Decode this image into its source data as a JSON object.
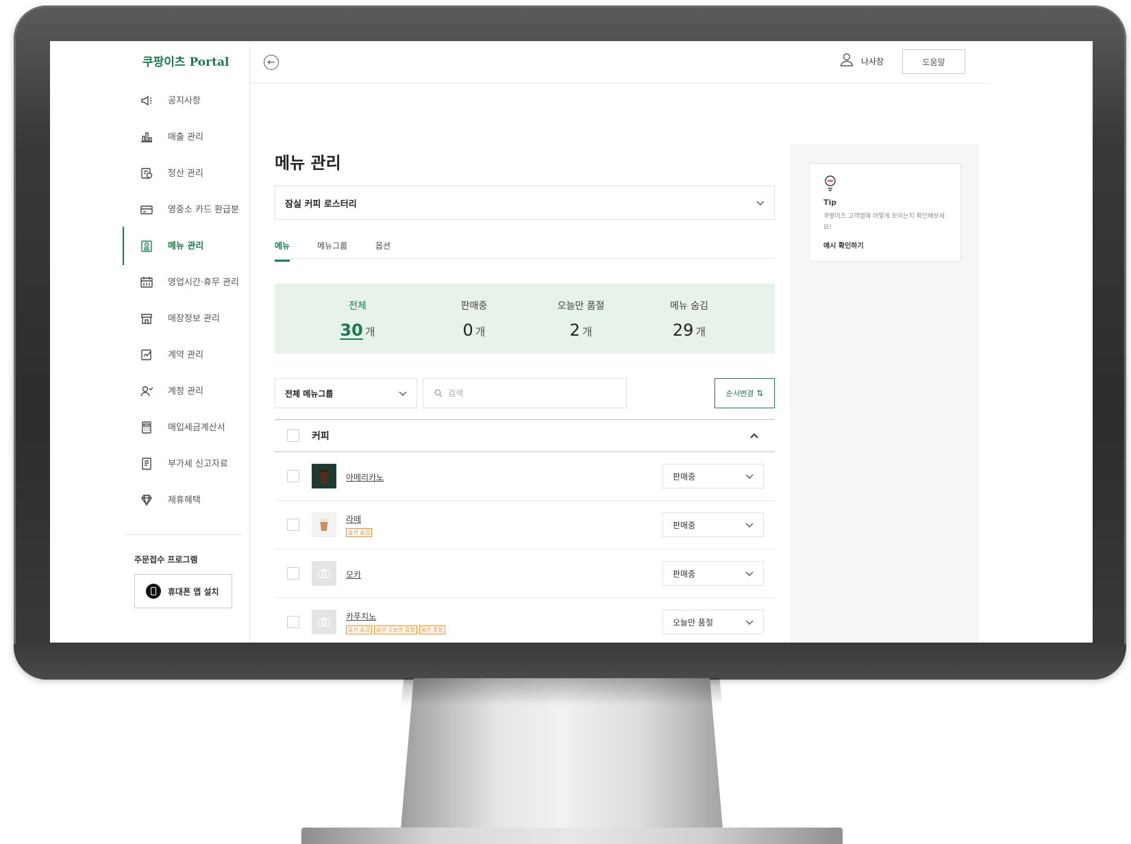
{
  "app": {
    "logo": "쿠팡이츠 Portal"
  },
  "header": {
    "user_name": "나사장",
    "help_label": "도움말"
  },
  "sidebar": {
    "items": [
      {
        "label": "공지사항",
        "icon": "megaphone-icon"
      },
      {
        "label": "매출 관리",
        "icon": "bar-chart-icon"
      },
      {
        "label": "정산 관리",
        "icon": "settlement-icon"
      },
      {
        "label": "영중소 카드 환급분",
        "icon": "card-icon"
      },
      {
        "label": "메뉴 관리",
        "icon": "menu-icon",
        "active": true
      },
      {
        "label": "영업시간·휴무 관리",
        "icon": "calendar-icon"
      },
      {
        "label": "매장정보 관리",
        "icon": "store-icon"
      },
      {
        "label": "계약 관리",
        "icon": "contract-icon"
      },
      {
        "label": "계정 관리",
        "icon": "account-icon"
      },
      {
        "label": "매입세금계산서",
        "icon": "calculator-icon"
      },
      {
        "label": "부가세 신고자료",
        "icon": "document-icon"
      },
      {
        "label": "제휴혜택",
        "icon": "diamond-icon"
      }
    ],
    "section_title": "주문접수 프로그램",
    "app_button_label": "휴대폰 앱 설치"
  },
  "main": {
    "title": "메뉴 관리",
    "store_select": "잠실 커피 로스터리",
    "tabs": [
      {
        "label": "메뉴",
        "active": true
      },
      {
        "label": "메뉴그룹"
      },
      {
        "label": "옵션"
      }
    ],
    "stats": [
      {
        "label": "전체",
        "value": "30",
        "unit": "개",
        "active": true
      },
      {
        "label": "판매중",
        "value": "0",
        "unit": "개"
      },
      {
        "label": "오늘만 품절",
        "value": "2",
        "unit": "개"
      },
      {
        "label": "메뉴 숨김",
        "value": "29",
        "unit": "개"
      }
    ],
    "group_filter": "전체 메뉴그룹",
    "search_placeholder": "검색",
    "reorder_label": "순서변경",
    "category": "커피",
    "items": [
      {
        "name": "아메리카노",
        "status": "판매중",
        "tags": [],
        "thumb": "coffee-dark"
      },
      {
        "name": "라떼",
        "status": "판매중",
        "tags": [
          "옵션 숨김"
        ],
        "thumb": "latte"
      },
      {
        "name": "모카",
        "status": "판매중",
        "tags": [],
        "thumb": "placeholder"
      },
      {
        "name": "카푸치노",
        "status": "오늘만 품절",
        "tags": [
          "옵션 숨김",
          "옵션 오늘만 품절",
          "옵션 품절"
        ],
        "thumb": "placeholder"
      }
    ]
  },
  "tip": {
    "title": "Tip",
    "body": "쿠팡이츠 고객앱에 어떻게 보이는지 확인해보세요!",
    "link": "예시 확인하기"
  },
  "colors": {
    "accent": "#1f7a4d",
    "stats_bg": "#e6f2ea",
    "tag": "#f08a24"
  }
}
